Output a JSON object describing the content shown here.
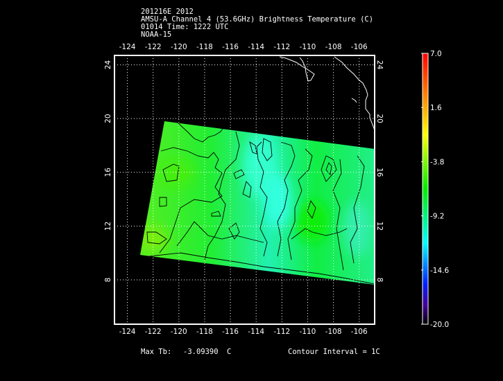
{
  "chart_data": {
    "type": "heatmap",
    "title_lines": [
      "201216E 2012",
      "AMSU-A Channel 4 (53.6GHz) Brightness Temperature (C)",
      "01014 Time: 1222 UTC",
      "NOAA-15"
    ],
    "x_ticks": [
      "-124",
      "-122",
      "-120",
      "-118",
      "-116",
      "-114",
      "-112",
      "-110",
      "-108",
      "-106"
    ],
    "x_tick_values": [
      -124,
      -122,
      -120,
      -118,
      -116,
      -114,
      -112,
      -110,
      -108,
      -106
    ],
    "y_ticks": [
      "24",
      "20",
      "16",
      "12",
      "8"
    ],
    "y_tick_values": [
      24,
      20,
      16,
      12,
      8
    ],
    "xlim": [
      -125,
      -104.8
    ],
    "ylim": [
      4.7,
      24.7
    ],
    "grid": true,
    "colorbar": {
      "labels": [
        "7.0",
        "1.6",
        "-3.8",
        "-9.2",
        "-14.6",
        "-20.0"
      ],
      "values": [
        7.0,
        1.6,
        -3.8,
        -9.2,
        -14.6,
        -20.0
      ],
      "range": [
        -20.0,
        7.0
      ],
      "placement": "right"
    },
    "swath_corners_lonlat": [
      [
        -122.5,
        19.9
      ],
      [
        -104.8,
        17.8
      ],
      [
        -104.8,
        7.7
      ],
      [
        -124.5,
        9.9
      ]
    ],
    "value_range_in_swath": [
      -9,
      -3.1
    ]
  },
  "footer": {
    "max_tb_label": "Max Tb:",
    "max_tb_value": "-3.09390",
    "max_tb_unit": "C",
    "contour_interval": "Contour Interval = 1C"
  }
}
